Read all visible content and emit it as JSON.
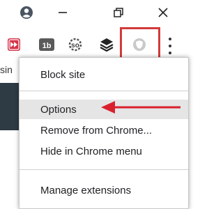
{
  "window": {
    "profile_icon": "account-circle-icon",
    "restore_icon": "restore-window-icon",
    "close_icon": "close-window-icon"
  },
  "toolbar": {
    "extensions": [
      {
        "name": "red-ff-extension",
        "icon": "fast-forward-badge-icon"
      },
      {
        "name": "1b-extension",
        "icon": "1b-badge-icon"
      },
      {
        "name": "so-extension",
        "icon": "gear-so-icon"
      },
      {
        "name": "layers-extension",
        "icon": "layers-icon"
      },
      {
        "name": "block-site-extension",
        "icon": "shield-icon"
      }
    ],
    "menu_icon": "three-dots-vertical-icon"
  },
  "background": {
    "left_text": "sin"
  },
  "menu": {
    "items": [
      {
        "label": "Block site"
      },
      {
        "label": "Options"
      },
      {
        "label": "Remove from Chrome..."
      },
      {
        "label": "Hide in Chrome menu"
      },
      {
        "label": "Manage extensions"
      }
    ]
  },
  "colors": {
    "highlight": "#d23a3a",
    "arrow": "#d9202e"
  }
}
